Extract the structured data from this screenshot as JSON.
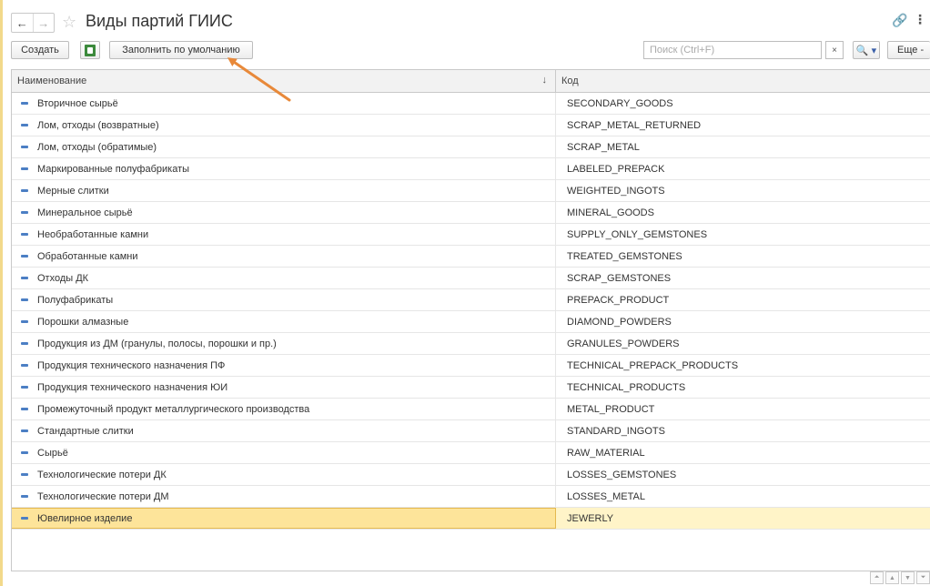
{
  "window": {
    "title": "Виды партий ГИИС",
    "back_glyph": "←",
    "forward_glyph": "→",
    "favorite_glyph": "☆",
    "link_glyph": "🔗",
    "more_glyph": "⋮"
  },
  "toolbar": {
    "create_label": "Создать",
    "fill_default_label": "Заполнить по умолчанию",
    "search_placeholder": "Поиск (Ctrl+F)",
    "search_value": "",
    "clear_glyph": "×",
    "search_glyph": "🔍 ▾",
    "more_label": "Еще -"
  },
  "table": {
    "columns": {
      "name": "Наименование",
      "name_sort_glyph": "↓",
      "code": "Код"
    },
    "rows": [
      {
        "name": "Вторичное сырьё",
        "code": "SECONDARY_GOODS"
      },
      {
        "name": "Лом, отходы (возвратные)",
        "code": "SCRAP_METAL_RETURNED"
      },
      {
        "name": "Лом, отходы (обратимые)",
        "code": "SCRAP_METAL"
      },
      {
        "name": "Маркированные полуфабрикаты",
        "code": "LABELED_PREPACK"
      },
      {
        "name": "Мерные слитки",
        "code": "WEIGHTED_INGOTS"
      },
      {
        "name": "Минеральное сырьё",
        "code": "MINERAL_GOODS"
      },
      {
        "name": "Необработанные камни",
        "code": "SUPPLY_ONLY_GEMSTONES"
      },
      {
        "name": "Обработанные камни",
        "code": "TREATED_GEMSTONES"
      },
      {
        "name": "Отходы ДК",
        "code": "SCRAP_GEMSTONES"
      },
      {
        "name": "Полуфабрикаты",
        "code": "PREPACK_PRODUCT"
      },
      {
        "name": "Порошки алмазные",
        "code": "DIAMOND_POWDERS"
      },
      {
        "name": "Продукция из ДМ (гранулы, полосы, порошки и пр.)",
        "code": "GRANULES_POWDERS"
      },
      {
        "name": "Продукция технического назначения ПФ",
        "code": "TECHNICAL_PREPACK_PRODUCTS"
      },
      {
        "name": "Продукция технического назначения ЮИ",
        "code": "TECHNICAL_PRODUCTS"
      },
      {
        "name": "Промежуточный продукт металлургического производства",
        "code": "METAL_PRODUCT"
      },
      {
        "name": "Стандартные слитки",
        "code": "STANDARD_INGOTS"
      },
      {
        "name": "Сырьё",
        "code": "RAW_MATERIAL"
      },
      {
        "name": "Технологические потери ДК",
        "code": "LOSSES_GEMSTONES"
      },
      {
        "name": "Технологические потери ДМ",
        "code": "LOSSES_METAL"
      },
      {
        "name": "Ювелирное изделие",
        "code": "JEWERLY",
        "selected": true
      }
    ]
  },
  "scroll": {
    "first_glyph": "⏶",
    "up_glyph": "▲",
    "down_glyph": "▼",
    "last_glyph": "⏷"
  },
  "colors": {
    "accent": "#e8893a",
    "selected_row": "#fde49a",
    "row_icon": "#4c7fc4"
  }
}
